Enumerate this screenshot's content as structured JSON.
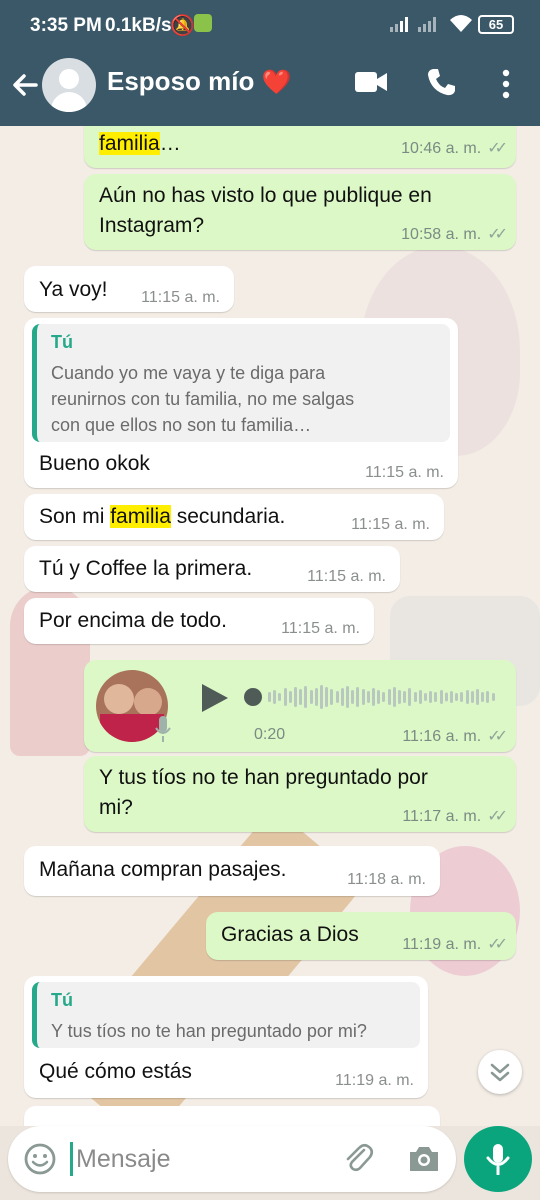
{
  "status_bar": {
    "time": "3:35 PM",
    "speed": "0.1kB/s",
    "battery": "65"
  },
  "header": {
    "contact_name": "Esposo mío",
    "heart": "❤️",
    "icons": [
      "back-arrow-icon",
      "avatar-placeholder",
      "video-call-icon",
      "phone-call-icon",
      "more-vertical-icon"
    ]
  },
  "messages": [
    {
      "dir": "out",
      "text": "familia…",
      "time": "10:46 a. m.",
      "highlight": "familia"
    },
    {
      "dir": "out",
      "line1": "Aún no has visto lo que publique en",
      "line2": "Instagram?",
      "time": "10:58 a. m."
    },
    {
      "dir": "in",
      "text": "Ya voy!",
      "time": "11:15 a. m."
    },
    {
      "dir": "in",
      "quote_author": "Tú",
      "quote_line1": "Cuando yo me vaya y te diga para",
      "quote_line2": "reunirnos con tu familia, no me salgas",
      "quote_line3": "con que ellos no son tu familia…",
      "text": "Bueno okok",
      "time": "11:15 a. m."
    },
    {
      "dir": "in",
      "text_before": "Son mi ",
      "highlight": "familia",
      "text_after": " secundaria.",
      "time": "11:15 a. m."
    },
    {
      "dir": "in",
      "text": "Tú y Coffee la primera.",
      "time": "11:15 a. m."
    },
    {
      "dir": "in",
      "text": "Por encima de todo.",
      "time": "11:15 a. m."
    },
    {
      "dir": "out",
      "type": "voice",
      "duration": "0:20",
      "time": "11:16 a. m."
    },
    {
      "dir": "out",
      "line1": "Y tus tíos no te han preguntado por",
      "line2": "mi?",
      "time": "11:17 a. m."
    },
    {
      "dir": "in",
      "text": "Mañana compran pasajes.",
      "time": "11:18 a. m."
    },
    {
      "dir": "out",
      "text": "Gracias a Dios",
      "time": "11:19 a. m."
    },
    {
      "dir": "in",
      "quote_author": "Tú",
      "quote_line1": "Y tus tíos no te han preguntado por mi?",
      "text": "Qué cómo estás",
      "time": "11:19 a. m."
    }
  ],
  "input": {
    "placeholder": "Mensaje"
  },
  "colors": {
    "header": "#3b5868",
    "outgoing_bubble": "#dcf8c6",
    "incoming_bubble": "#ffffff",
    "highlight": "#ffee00",
    "accent": "#26a98a",
    "mic_button": "#0aa57d"
  }
}
